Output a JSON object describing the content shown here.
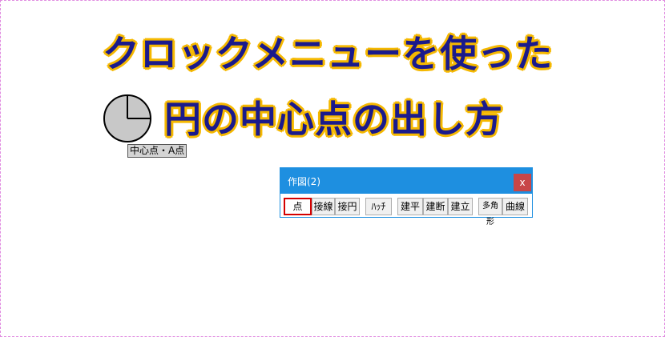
{
  "title": {
    "line1": "クロックメニューを使った",
    "line2": "円の中心点の出し方"
  },
  "clock": {
    "icon": "clock-icon",
    "label": "中心点・A点"
  },
  "dialog": {
    "title": "作図(2)",
    "close_label": "x",
    "buttons": [
      {
        "label": "点",
        "active": true
      },
      {
        "label": "接線"
      },
      {
        "label": "接円"
      },
      {
        "label": "ﾊｯﾁ"
      },
      {
        "label": "建平"
      },
      {
        "label": "建断"
      },
      {
        "label": "建立"
      },
      {
        "label": "多角形"
      },
      {
        "label": "曲線"
      }
    ]
  },
  "colors": {
    "title_fill": "#1a1a8c",
    "title_outline": "#f5b800",
    "dialog_accent": "#1e8fe0",
    "close_button": "#c84648",
    "active_outline": "#d40000"
  }
}
